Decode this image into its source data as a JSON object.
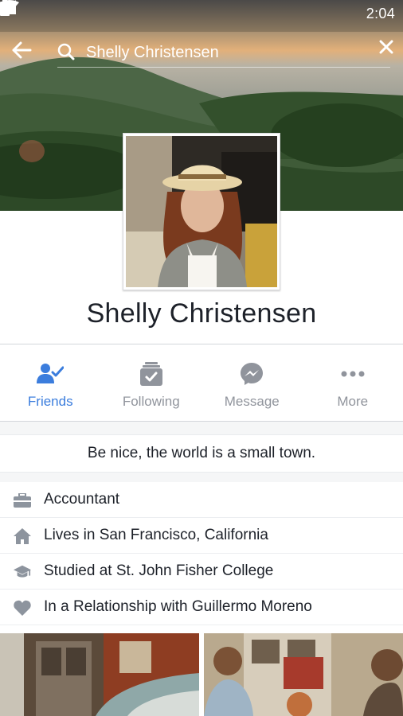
{
  "status_bar": {
    "time": "2:04"
  },
  "search": {
    "query": "Shelly Christensen"
  },
  "profile": {
    "name": "Shelly Christensen",
    "bio": "Be nice, the world is a small town."
  },
  "actions": [
    {
      "label": "Friends",
      "icon": "friends-icon",
      "active": true
    },
    {
      "label": "Following",
      "icon": "following-icon",
      "active": false
    },
    {
      "label": "Message",
      "icon": "messenger-icon",
      "active": false
    },
    {
      "label": "More",
      "icon": "more-icon",
      "active": false
    }
  ],
  "info": [
    {
      "icon": "briefcase-icon",
      "text": "Accountant"
    },
    {
      "icon": "home-icon",
      "text": "Lives in San Francisco, California"
    },
    {
      "icon": "graduation-cap-icon",
      "text": "Studied at St. John Fisher College"
    },
    {
      "icon": "heart-icon",
      "text": "In a Relationship with Guillermo Moreno"
    }
  ],
  "colors": {
    "accent": "#3b7ddd",
    "muted": "#90949c",
    "text": "#1d2129"
  }
}
